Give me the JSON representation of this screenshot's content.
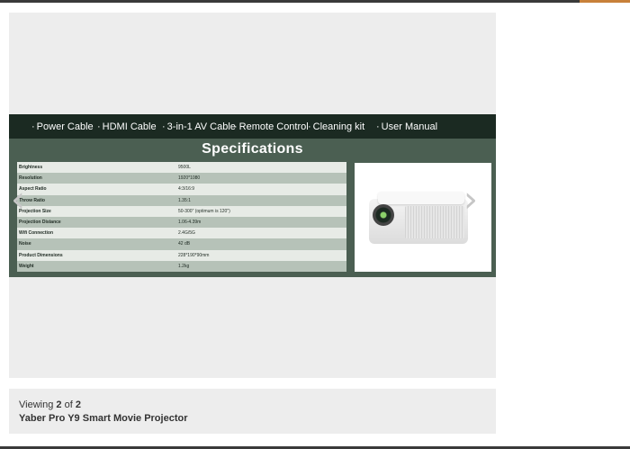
{
  "accessories": [
    {
      "label": "Power Cable"
    },
    {
      "label": "HDMI Cable"
    },
    {
      "label": "3-in-1 AV Cable"
    },
    {
      "label": "Remote Control"
    },
    {
      "label": "Cleaning kit"
    },
    {
      "label": "User Manual"
    }
  ],
  "specs": {
    "title": "Specifications",
    "rows": [
      {
        "name": "Brightness",
        "value": "9500L"
      },
      {
        "name": "Resolution",
        "value": "1920*1080"
      },
      {
        "name": "Aspect Ratio",
        "value": "4:3/16:9"
      },
      {
        "name": "Throw Ratio",
        "value": "1.35:1"
      },
      {
        "name": "Projection Size",
        "value": "50-300\" (optimum is 120\")"
      },
      {
        "name": "Projection Distance",
        "value": "1.06-4.39m"
      },
      {
        "name": "Wifi Connection",
        "value": "2.4G/5G"
      },
      {
        "name": "Noise",
        "value": "42 dB"
      },
      {
        "name": "Product Dimensions",
        "value": "228*190*90mm"
      },
      {
        "name": "Weight",
        "value": "1.2kg"
      }
    ]
  },
  "nav": {
    "prev": "‹",
    "next": "›",
    "prev_icon": "chevron-left-icon",
    "next_icon": "chevron-right-icon"
  },
  "caption": {
    "viewing_prefix": "Viewing",
    "current": "2",
    "of_text": "of",
    "total": "2",
    "title": "Yaber Pro Y9 Smart Movie Projector"
  },
  "colors": {
    "accent": "#4b5f52",
    "strip": "#1b2a22"
  }
}
